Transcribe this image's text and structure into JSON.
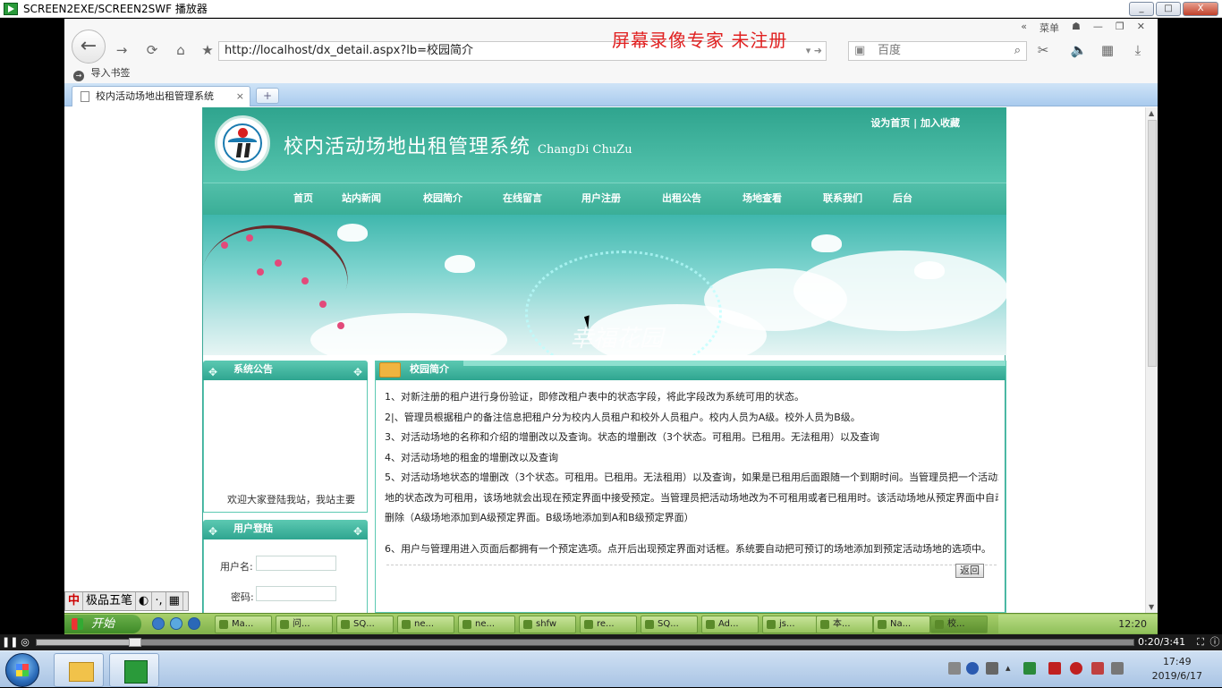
{
  "outer_window": {
    "title": "SCREEN2EXE/SCREEN2SWF 播放器",
    "min_label": "_",
    "max_label": "□",
    "close_label": "X"
  },
  "browser": {
    "address": "http://localhost/dx_detail.aspx?lb=校园简介",
    "search_placeholder": "百度",
    "watermark": "屏幕录像专家  未注册",
    "menu_label": "菜单",
    "bookmark_label": "导入书签",
    "tab_title": "校内活动场地出租管理系统",
    "tab_close": "×",
    "newtab_label": "+"
  },
  "site": {
    "title": "校内活动场地出租管理系统",
    "title_en": "ChangDi ChuZu",
    "head_links": "设为首页 | 加入收藏",
    "nav": [
      {
        "label": "首页"
      },
      {
        "label": "站内新闻"
      },
      {
        "label": "校园简介"
      },
      {
        "label": "在线留言"
      },
      {
        "label": "用户注册"
      },
      {
        "label": "出租公告"
      },
      {
        "label": "场地查看"
      },
      {
        "label": "联系我们"
      },
      {
        "label": "后台"
      }
    ],
    "banner_text": "幸福花园",
    "notice": {
      "title": "系统公告",
      "welcome": "欢迎大家登陆我站，我站主要"
    },
    "login": {
      "title": "用户登陆",
      "username_label": "用户名:",
      "password_label": "密码:"
    },
    "main": {
      "title": "校园简介",
      "paragraphs": [
        "1、对新注册的租户进行身份验证，即修改租户表中的状态字段，将此字段改为系统可用的状态。",
        "2|、管理员根据租户的备注信息把租户分为校内人员租户和校外人员租户。校内人员为A级。校外人员为B级。",
        "3、对活动场地的名称和介绍的增删改以及查询。状态的增删改（3个状态。可租用。已租用。无法租用）以及查询",
        "4、对活动场地的租金的增删改以及查询",
        "5、对活动场地状态的增删改（3个状态。可租用。已租用。无法租用）以及查询，如果是已租用后面跟随一个到期时间。当管理员把一个活动场",
        "地的状态改为可租用，该场地就会出现在预定界面中接受预定。当管理员把活动场地改为不可租用或者已租用时。该活动场地从预定界面中自动",
        "删除（A级场地添加到A级预定界面。B级场地添加到A和B级预定界面）"
      ],
      "paragraph_6": "6、用户与管理用进入页面后都拥有一个预定选项。点开后出现预定界面对话框。系统要自动把可预订的场地添加到预定活动场地的选项中。",
      "back_label": "返回"
    }
  },
  "ime": {
    "label": "极品五笔",
    "items": [
      "中",
      "极品五笔",
      "◐",
      "·,",
      "▦"
    ]
  },
  "inner_taskbar": {
    "start_label": "开始",
    "tasks": [
      "Ma...",
      "问...",
      "SQ...",
      "ne...",
      "ne...",
      "shfw",
      "re...",
      "SQ...",
      "Ad...",
      "js...",
      "本...",
      "Na...",
      "校..."
    ],
    "time": "12:20"
  },
  "player": {
    "time": "0:20/3:41",
    "progress_fraction": 0.09
  },
  "win7_taskbar": {
    "time": "17:49",
    "date": "2019/6/17"
  }
}
